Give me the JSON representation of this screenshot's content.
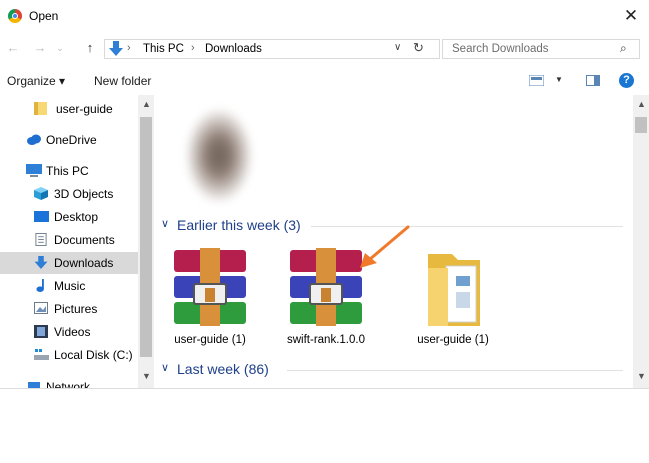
{
  "window": {
    "title": "Open"
  },
  "address": {
    "segments": [
      "This PC",
      "Downloads"
    ]
  },
  "search": {
    "placeholder": "Search Downloads"
  },
  "toolbar": {
    "organize_label": "Organize ▾",
    "new_folder_label": "New folder"
  },
  "nav": {
    "items": [
      {
        "label": "user-guide",
        "icon": "folder-icon"
      },
      {
        "label": "OneDrive",
        "icon": "cloud-icon"
      },
      {
        "label": "This PC",
        "icon": "computer-icon"
      },
      {
        "label": "3D Objects",
        "icon": "cube-icon"
      },
      {
        "label": "Desktop",
        "icon": "desktop-icon"
      },
      {
        "label": "Documents",
        "icon": "document-icon"
      },
      {
        "label": "Downloads",
        "icon": "download-icon",
        "selected": true
      },
      {
        "label": "Music",
        "icon": "music-icon"
      },
      {
        "label": "Pictures",
        "icon": "pictures-icon"
      },
      {
        "label": "Videos",
        "icon": "videos-icon"
      },
      {
        "label": "Local Disk (C:)",
        "icon": "disk-icon"
      },
      {
        "label": "Network",
        "icon": "network-icon"
      }
    ]
  },
  "content": {
    "groups": [
      {
        "label": "Earlier this week (3)"
      },
      {
        "label": "Last week (86)"
      }
    ],
    "files": [
      {
        "name": "user-guide (1)",
        "type": "archive-icon"
      },
      {
        "name": "swift-rank.1.0.0",
        "type": "archive-icon"
      },
      {
        "name": "user-guide (1)",
        "type": "folder-icon"
      }
    ]
  },
  "colors": {
    "accent": "#1e3f8a",
    "selection": "#d9d9d9",
    "annotation_arrow": "#f07a2a"
  }
}
